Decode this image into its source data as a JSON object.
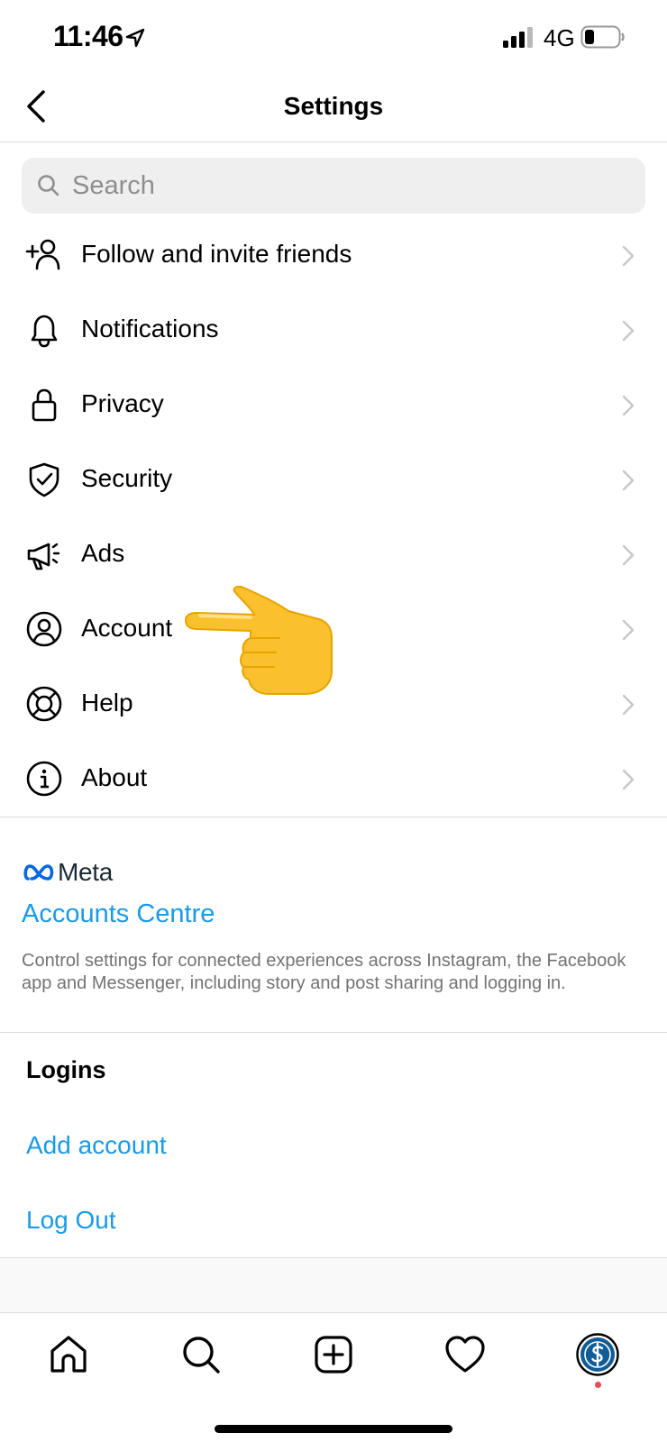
{
  "status_bar": {
    "time": "11:46",
    "network": "4G"
  },
  "header": {
    "title": "Settings"
  },
  "search": {
    "placeholder": "Search"
  },
  "menu": [
    {
      "label": "Follow and invite friends",
      "icon": "add-person-icon"
    },
    {
      "label": "Notifications",
      "icon": "bell-icon"
    },
    {
      "label": "Privacy",
      "icon": "lock-icon"
    },
    {
      "label": "Security",
      "icon": "shield-check-icon"
    },
    {
      "label": "Ads",
      "icon": "megaphone-icon"
    },
    {
      "label": "Account",
      "icon": "person-circle-icon"
    },
    {
      "label": "Help",
      "icon": "lifebuoy-icon"
    },
    {
      "label": "About",
      "icon": "info-icon"
    }
  ],
  "meta": {
    "logo_text": "Meta",
    "accounts_centre": "Accounts Centre",
    "description": "Control settings for connected experiences across Instagram, the Facebook app and Messenger, including story and post sharing and logging in."
  },
  "logins": {
    "title": "Logins",
    "add_account": "Add account",
    "log_out": "Log Out"
  },
  "tab_bar": {
    "tabs": [
      "home-icon",
      "search-icon",
      "create-icon",
      "heart-icon",
      "profile-avatar"
    ]
  },
  "colors": {
    "link": "#1a9ae8",
    "divider": "#dbdbdb",
    "notification_dot": "#ed4956",
    "meta_blue": "#0668e1"
  }
}
